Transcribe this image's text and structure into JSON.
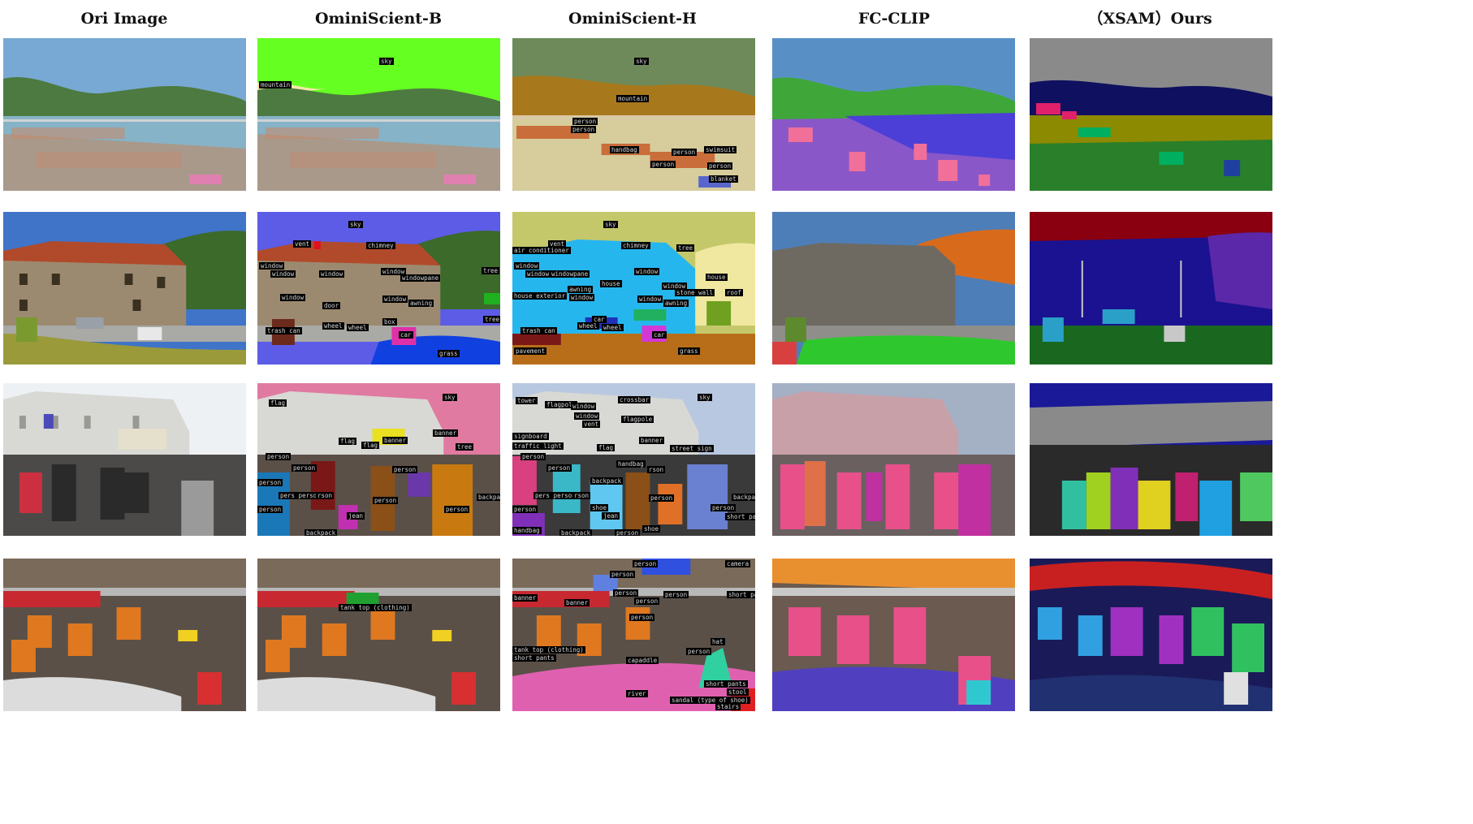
{
  "headers": {
    "ori": "Ori Image",
    "b": "OminiScient-B",
    "h": "OminiScient-H",
    "fc": "FC-CLIP",
    "ours": "（XSAM）Ours"
  },
  "rows": {
    "r1": {
      "b": [
        "sky",
        "mountain"
      ],
      "h": [
        "sky",
        "mountain",
        "person",
        "person",
        "handbag",
        "person",
        "swimsuit",
        "person",
        "person",
        "blanket"
      ]
    },
    "r2": {
      "b": [
        "sky",
        "vent",
        "chimney",
        "window",
        "window",
        "window",
        "window",
        "windowpane",
        "window",
        "door",
        "window",
        "awning",
        "wheel",
        "wheel",
        "trash can",
        "box",
        "car",
        "grass",
        "tree",
        "tree"
      ],
      "h": [
        "sky",
        "vent",
        "air conditioner",
        "chimney",
        "tree",
        "window",
        "window",
        "windowpane",
        "window",
        "house",
        "awning",
        "window",
        "house exterior",
        "window",
        "stone wall",
        "window",
        "awning",
        "car",
        "wheel",
        "wheel",
        "trash can",
        "car",
        "pavement",
        "grass",
        "house",
        "roof"
      ]
    },
    "r3": {
      "b": [
        "flag",
        "sky",
        "flag",
        "flag",
        "banner",
        "banner",
        "tree",
        "person",
        "person",
        "person",
        "person",
        "pers person",
        "rson",
        "person",
        "jean",
        "backpack",
        "person",
        "backpack",
        "person"
      ],
      "h": [
        "tower",
        "flagpole",
        "window",
        "crossbar",
        "sky",
        "window",
        "vent",
        "flagpole",
        "signboard",
        "traffic light",
        "flag",
        "banner",
        "street sign",
        "person",
        "handbag",
        "rson",
        "person",
        "backpack",
        "person",
        "person",
        "pers person",
        "rson",
        "shoe",
        "jean",
        "backpack",
        "shoe",
        "person",
        "short pants",
        "handbag",
        "person",
        "backpack"
      ]
    },
    "r4": {
      "b": [
        "tank top (clothing)"
      ],
      "h": [
        "person",
        "camera",
        "person",
        "banner",
        "banner",
        "person",
        "person",
        "person",
        "short pants",
        "person",
        "tank top (clothing)",
        "short pants",
        "capaddle",
        "person",
        "hat",
        "short pants",
        "stool",
        "river",
        "sandal (type of shoe)",
        "stairs"
      ]
    }
  },
  "colors": {
    "sky_blue": "#6fa8d8",
    "mountain_green": "#4f7d43",
    "water": "#7fb0c8",
    "sand": "#b9aa98",
    "omni_b_sky": "#66ff22",
    "omni_h_sky": "#6e8a5a"
  }
}
